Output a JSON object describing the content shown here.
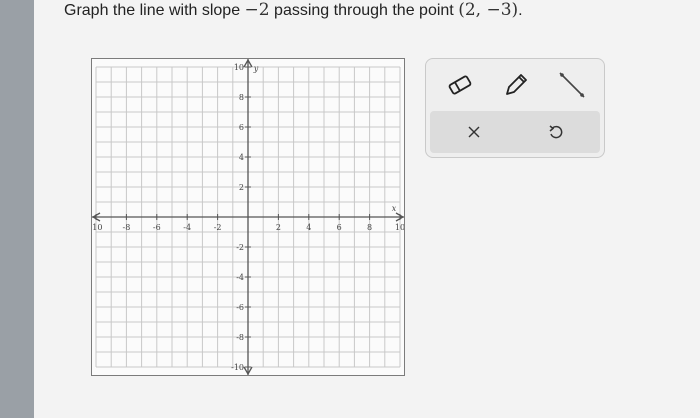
{
  "question": {
    "prefix": "Graph the line with slope ",
    "slope": "−2",
    "middle": " passing through the point ",
    "point": "(2, −3)",
    "suffix": "."
  },
  "graph": {
    "x_axis_label": "x",
    "y_axis_label": "y",
    "x_ticks": [
      "-10",
      "-8",
      "-6",
      "-4",
      "-2",
      "2",
      "4",
      "6",
      "8",
      "10"
    ],
    "y_ticks": [
      "10",
      "8",
      "6",
      "4",
      "2",
      "-2",
      "-4",
      "-6",
      "-8",
      "-10"
    ],
    "x_range": [
      -10,
      10
    ],
    "y_range": [
      -10,
      10
    ],
    "grid": true
  },
  "tools": {
    "eraser": "eraser-icon",
    "pencil": "pencil-icon",
    "line": "line-segment-icon",
    "clear": "clear-icon",
    "undo": "undo-icon"
  },
  "colors": {
    "grid": "#c8c8c8",
    "axis": "#555555",
    "border": "#7b7b7b"
  }
}
